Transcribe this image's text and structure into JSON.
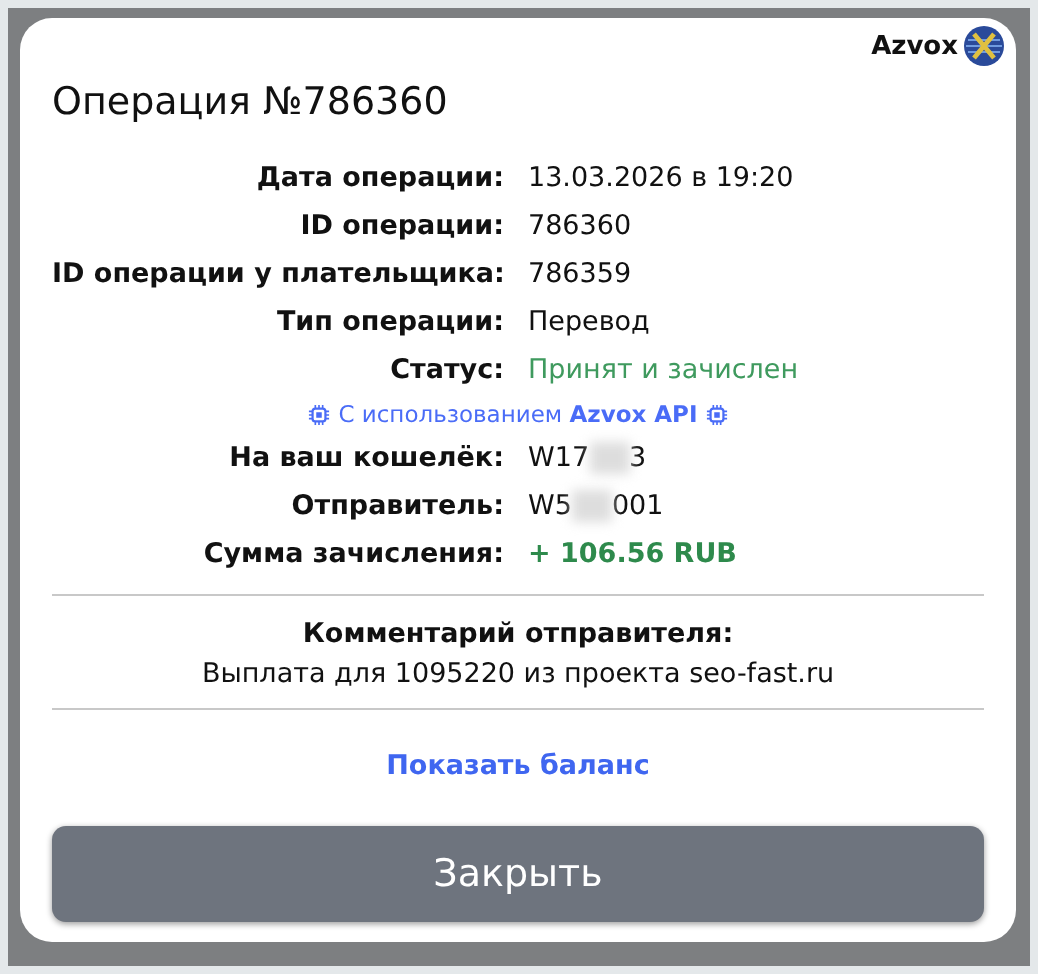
{
  "brand": {
    "name": "Azvox"
  },
  "title": "Операция №786360",
  "details": [
    {
      "kind": "text",
      "label": "Дата операции:",
      "value": "13.03.2026 в 19:20"
    },
    {
      "kind": "text",
      "label": "ID операции:",
      "value": "786360"
    },
    {
      "kind": "text",
      "label": "ID операции у плательщика:",
      "value": "786359"
    },
    {
      "kind": "text",
      "label": "Тип операции:",
      "value": "Перевод"
    },
    {
      "kind": "status",
      "label": "Статус:",
      "value": "Принят и зачислен"
    },
    {
      "kind": "note",
      "text": "С использованием **Azvox API**"
    },
    {
      "kind": "masked",
      "label": "На ваш кошелёк:",
      "value_start": "W17",
      "value_end": "3"
    },
    {
      "kind": "masked",
      "label": "Отправитель:",
      "value_start": "W5",
      "value_end": "001"
    },
    {
      "kind": "amount",
      "label": "Сумма зачисления:",
      "value": "+ 106.56 RUB"
    }
  ],
  "comment": {
    "title": "Комментарий отправителя:",
    "text": "Выплата для 1095220 из проекта seo-fast.ru"
  },
  "balance_link": "Показать баланс",
  "close_button": "Закрыть"
}
